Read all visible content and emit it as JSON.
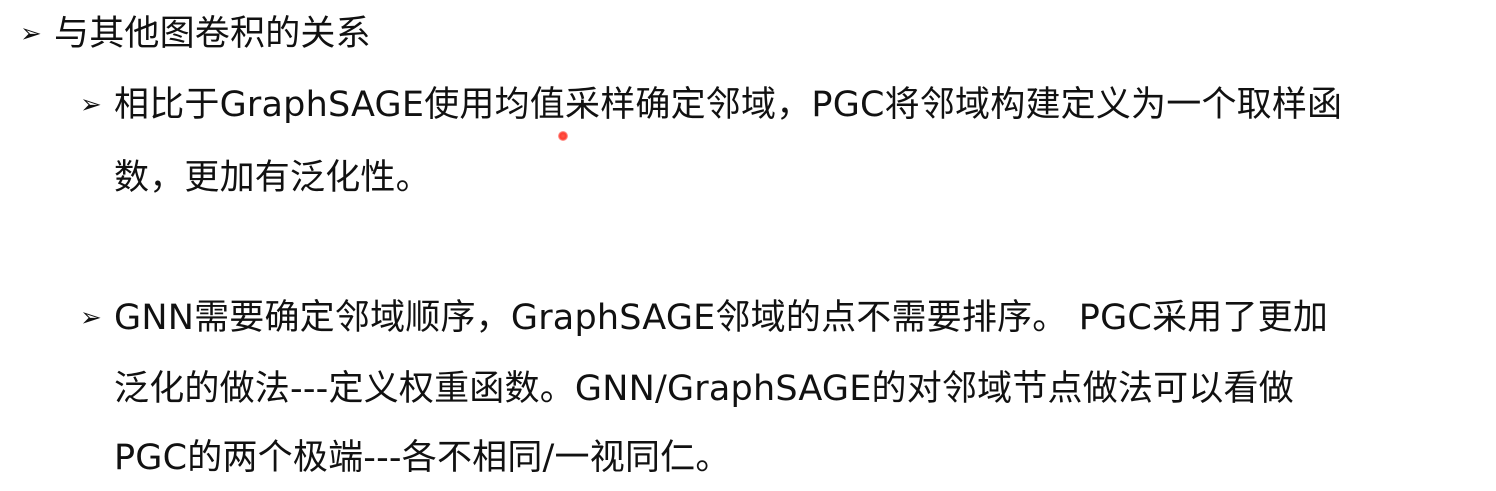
{
  "heading": {
    "bullet_icon": "arrowhead-bullet",
    "text": "与其他图卷积的关系"
  },
  "points": [
    {
      "bullet_icon": "arrowhead-bullet",
      "lines": [
        "相比于GraphSAGE使用均值采样确定邻域，PGC将邻域构建定义为一个取样函",
        "数，更加有泛化性。"
      ]
    },
    {
      "bullet_icon": "arrowhead-bullet",
      "lines": [
        "GNN需要确定邻域顺序，GraphSAGE邻域的点不需要排序。  PGC采用了更加",
        "泛化的做法---定义权重函数。GNN/GraphSAGE的对邻域节点做法可以看做",
        "PGC的两个极端---各不相同/一视同仁。"
      ]
    }
  ],
  "colors": {
    "text": "#111111",
    "background": "#ffffff",
    "laser_pointer": "#ff3b2f"
  }
}
